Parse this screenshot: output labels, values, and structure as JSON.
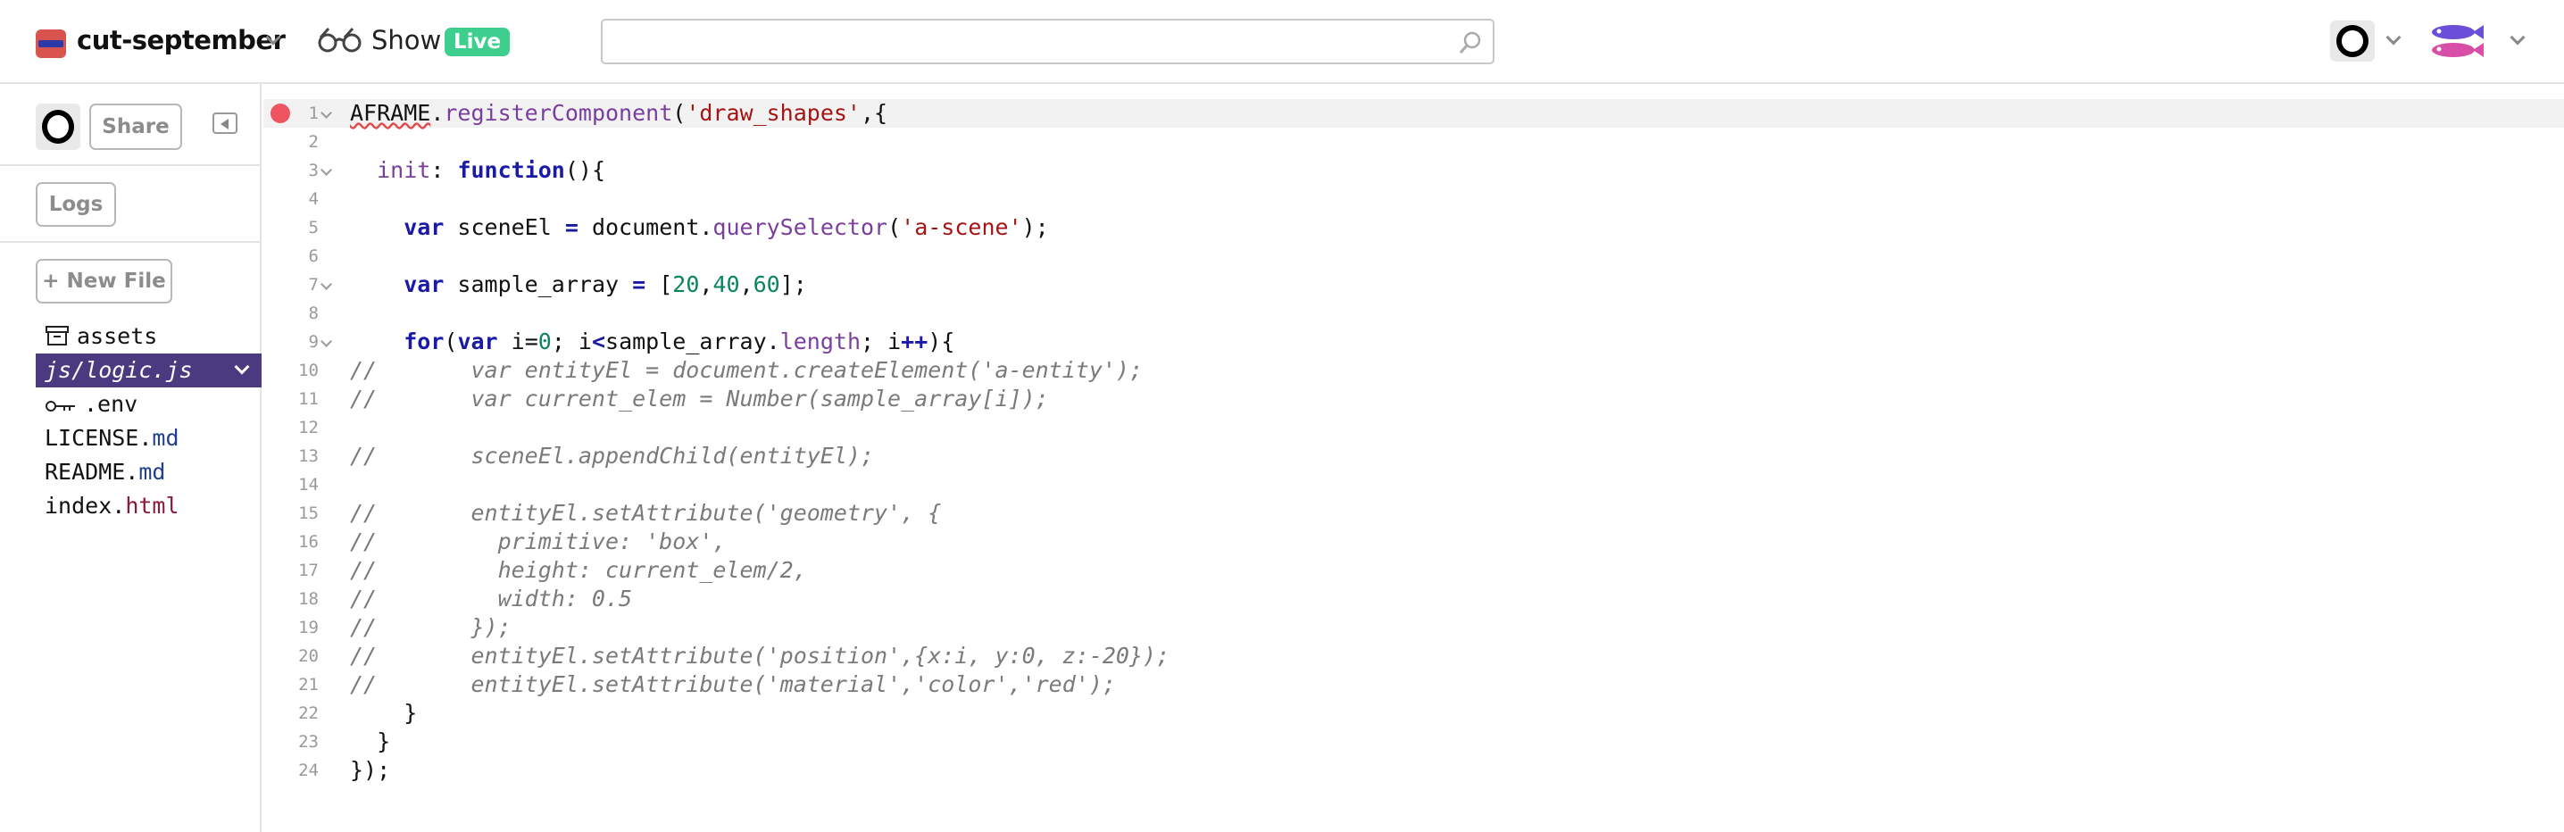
{
  "header": {
    "project_name": "cut-september",
    "show_label": "Show",
    "live_badge": "Live",
    "search": {
      "value": "",
      "placeholder": ""
    }
  },
  "sidebar": {
    "share_label": "Share",
    "logs_label": "Logs",
    "new_file_label": "+ New File",
    "files": [
      {
        "name": "assets",
        "ext": "",
        "icon": "archive-box-icon",
        "active": false
      },
      {
        "name": "js/logic.js",
        "ext": "",
        "icon": "",
        "active": true
      },
      {
        "name": ".env",
        "ext": "",
        "icon": "key-icon",
        "active": false
      },
      {
        "name": "LICENSE.",
        "ext": "md",
        "icon": "",
        "active": false
      },
      {
        "name": "README.",
        "ext": "md",
        "icon": "",
        "active": false
      },
      {
        "name": "index.",
        "ext": "html",
        "icon": "",
        "active": false
      }
    ]
  },
  "editor": {
    "current_line": 1,
    "error_line": 1,
    "fold_lines": [
      1,
      3,
      7,
      9
    ],
    "line_numbers": [
      "1",
      "2",
      "3",
      "4",
      "5",
      "6",
      "7",
      "8",
      "9",
      "10",
      "11",
      "12",
      "13",
      "14",
      "15",
      "16",
      "17",
      "18",
      "19",
      "20",
      "21",
      "22",
      "23",
      "24"
    ],
    "lines": [
      [
        [
          "AFRAME",
          "squig"
        ],
        [
          ".",
          ""
        ],
        [
          "registerComponent",
          "fn"
        ],
        [
          "(",
          ""
        ],
        [
          "'draw_shapes'",
          "str"
        ],
        [
          ",{",
          ""
        ]
      ],
      [],
      [
        [
          "  ",
          ""
        ],
        [
          "init",
          "prop"
        ],
        [
          ": ",
          ""
        ],
        [
          "function",
          "kw"
        ],
        [
          "(){",
          ""
        ]
      ],
      [],
      [
        [
          "    ",
          ""
        ],
        [
          "var",
          "kw"
        ],
        [
          " sceneEl ",
          ""
        ],
        [
          "=",
          "kw"
        ],
        [
          " document.",
          ""
        ],
        [
          "querySelector",
          "fn"
        ],
        [
          "(",
          ""
        ],
        [
          "'a-scene'",
          "str"
        ],
        [
          ");",
          ""
        ]
      ],
      [],
      [
        [
          "    ",
          ""
        ],
        [
          "var",
          "kw"
        ],
        [
          " sample_array ",
          ""
        ],
        [
          "=",
          "kw"
        ],
        [
          " [",
          ""
        ],
        [
          "20",
          "num"
        ],
        [
          ",",
          ""
        ],
        [
          "40",
          "num"
        ],
        [
          ",",
          ""
        ],
        [
          "60",
          "num"
        ],
        [
          "];",
          ""
        ]
      ],
      [],
      [
        [
          "    ",
          ""
        ],
        [
          "for",
          "kw"
        ],
        [
          "(",
          ""
        ],
        [
          "var",
          "kw"
        ],
        [
          " i=",
          ""
        ],
        [
          "0",
          "num"
        ],
        [
          "; i",
          ""
        ],
        [
          "<",
          "kw"
        ],
        [
          "sample_array.",
          ""
        ],
        [
          "length",
          "fn"
        ],
        [
          "; i",
          ""
        ],
        [
          "++",
          "kw"
        ],
        [
          "){",
          ""
        ]
      ],
      [
        [
          "//       var entityEl = document.createElement('a-entity');",
          "cmt"
        ]
      ],
      [
        [
          "//       var current_elem = Number(sample_array[i]);",
          "cmt"
        ]
      ],
      [],
      [
        [
          "//       sceneEl.appendChild(entityEl);",
          "cmt"
        ]
      ],
      [],
      [
        [
          "//       entityEl.setAttribute('geometry', {",
          "cmt"
        ]
      ],
      [
        [
          "//         primitive: 'box',",
          "cmt"
        ]
      ],
      [
        [
          "//         height: current_elem/2,",
          "cmt"
        ]
      ],
      [
        [
          "//         width: 0.5",
          "cmt"
        ]
      ],
      [
        [
          "//       });",
          "cmt"
        ]
      ],
      [
        [
          "//       entityEl.setAttribute('position',{x:i, y:0, z:-20});",
          "cmt"
        ]
      ],
      [
        [
          "//       entityEl.setAttribute('material','color','red');",
          "cmt"
        ]
      ],
      [
        [
          "    }",
          ""
        ]
      ],
      [
        [
          "  }",
          ""
        ]
      ],
      [
        [
          "});",
          ""
        ]
      ]
    ]
  }
}
